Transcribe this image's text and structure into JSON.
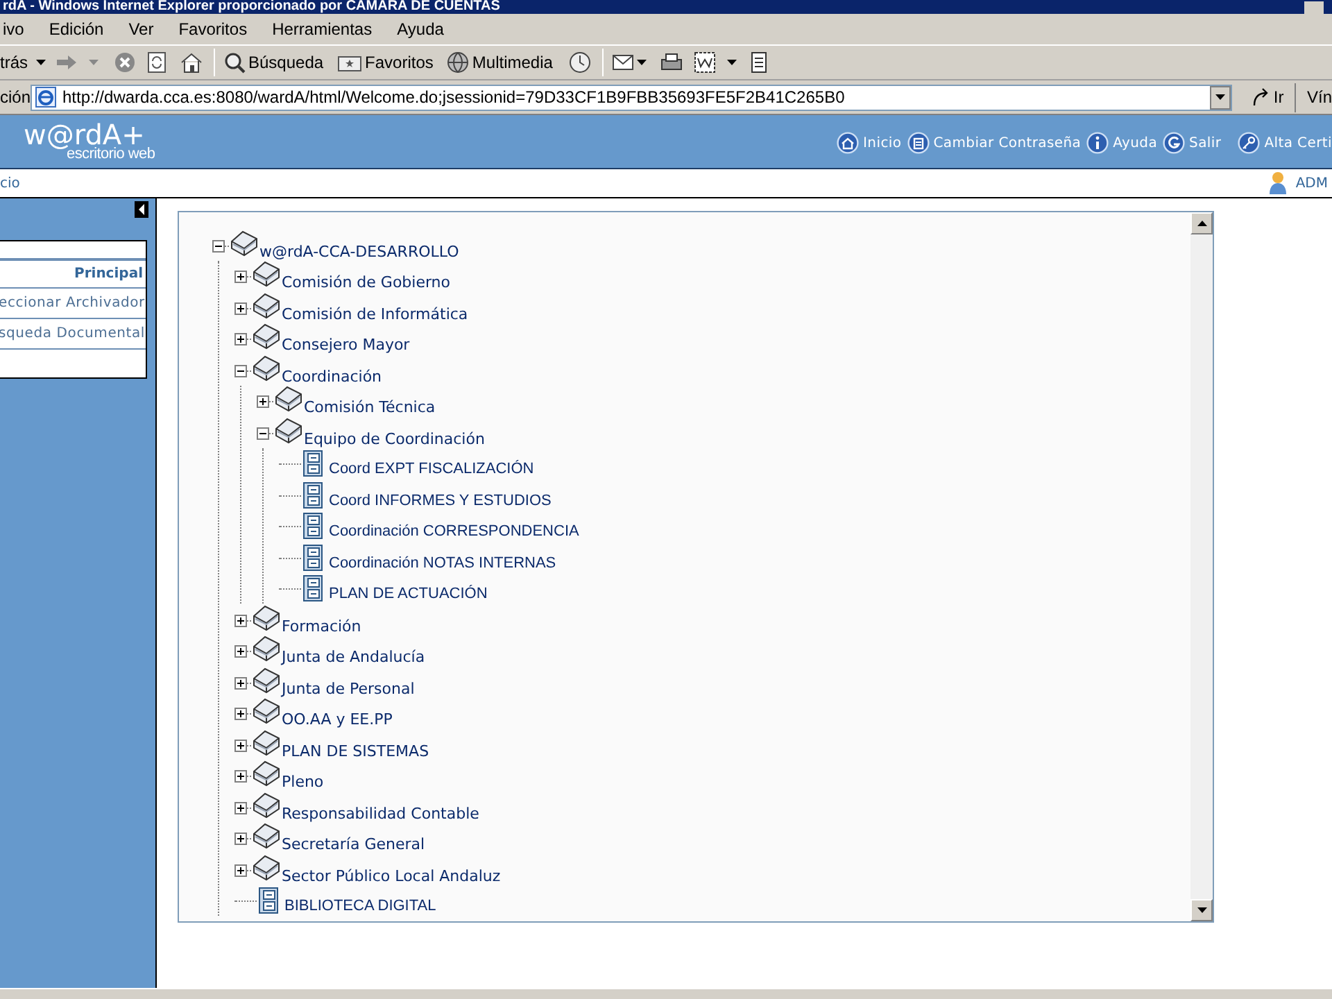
{
  "window": {
    "title": "rdA - Windows Internet Explorer proporcionado por CAMARA DE CUENTAS"
  },
  "menu_bar": [
    "ivo",
    "Edición",
    "Ver",
    "Favoritos",
    "Herramientas",
    "Ayuda"
  ],
  "toolbar": {
    "back": "trás",
    "search": "Búsqueda",
    "favorites": "Favoritos",
    "media": "Multimedia"
  },
  "address_bar": {
    "label": "ción",
    "url": "http://dwarda.cca.es:8080/wardA/html/Welcome.do;jsessionid=79D33CF1B9FBB35693FE5F2B41C265B0",
    "go": "Ir",
    "links": "Vín"
  },
  "header": {
    "logo": "w@rdA+",
    "subtitle": "escritorio web",
    "nav": [
      {
        "label": "Inicio",
        "kind": "home"
      },
      {
        "label": "Cambiar Contraseña",
        "kind": "lock"
      },
      {
        "label": "Ayuda",
        "kind": "info"
      },
      {
        "label": "Salir",
        "kind": "exit"
      },
      {
        "label": "Alta Certi",
        "kind": "key"
      }
    ]
  },
  "breadcrumb": "cio",
  "user": "ADM",
  "sidebar": {
    "heading": "Principal",
    "items": [
      "eccionar Archivador",
      "squeda Documental"
    ]
  },
  "tree": {
    "label": "w@rdA-CCA-DESARROLLO",
    "kind": "folder",
    "expanded": true,
    "children": [
      {
        "label": "Comisión de Gobierno",
        "kind": "folder",
        "expanded": false
      },
      {
        "label": "Comisión de Informática",
        "kind": "folder",
        "expanded": false
      },
      {
        "label": "Consejero Mayor",
        "kind": "folder",
        "expanded": false
      },
      {
        "label": "Coordinación",
        "kind": "folder",
        "expanded": true,
        "children": [
          {
            "label": "Comisión Técnica",
            "kind": "folder",
            "expanded": false
          },
          {
            "label": "Equipo de Coordinación",
            "kind": "folder",
            "expanded": true,
            "children": [
              {
                "label": "Coord EXPT FISCALIZACIÓN",
                "kind": "archive"
              },
              {
                "label": "Coord INFORMES Y ESTUDIOS",
                "kind": "archive"
              },
              {
                "label": "Coordinación CORRESPONDENCIA",
                "kind": "archive"
              },
              {
                "label": "Coordinación NOTAS INTERNAS",
                "kind": "archive"
              },
              {
                "label": "PLAN DE ACTUACIÓN",
                "kind": "archive"
              }
            ]
          }
        ]
      },
      {
        "label": "Formación",
        "kind": "folder",
        "expanded": false
      },
      {
        "label": "Junta de Andalucía",
        "kind": "folder",
        "expanded": false
      },
      {
        "label": "Junta de Personal",
        "kind": "folder",
        "expanded": false
      },
      {
        "label": "OO.AA y EE.PP",
        "kind": "folder",
        "expanded": false
      },
      {
        "label": "PLAN DE SISTEMAS",
        "kind": "folder",
        "expanded": false
      },
      {
        "label": "Pleno",
        "kind": "folder",
        "expanded": false
      },
      {
        "label": "Responsabilidad Contable",
        "kind": "folder",
        "expanded": false
      },
      {
        "label": "Secretaría General",
        "kind": "folder",
        "expanded": false
      },
      {
        "label": "Sector Público Local Andaluz",
        "kind": "folder",
        "expanded": false
      },
      {
        "label": "BIBLIOTECA DIGITAL",
        "kind": "archive"
      }
    ]
  }
}
